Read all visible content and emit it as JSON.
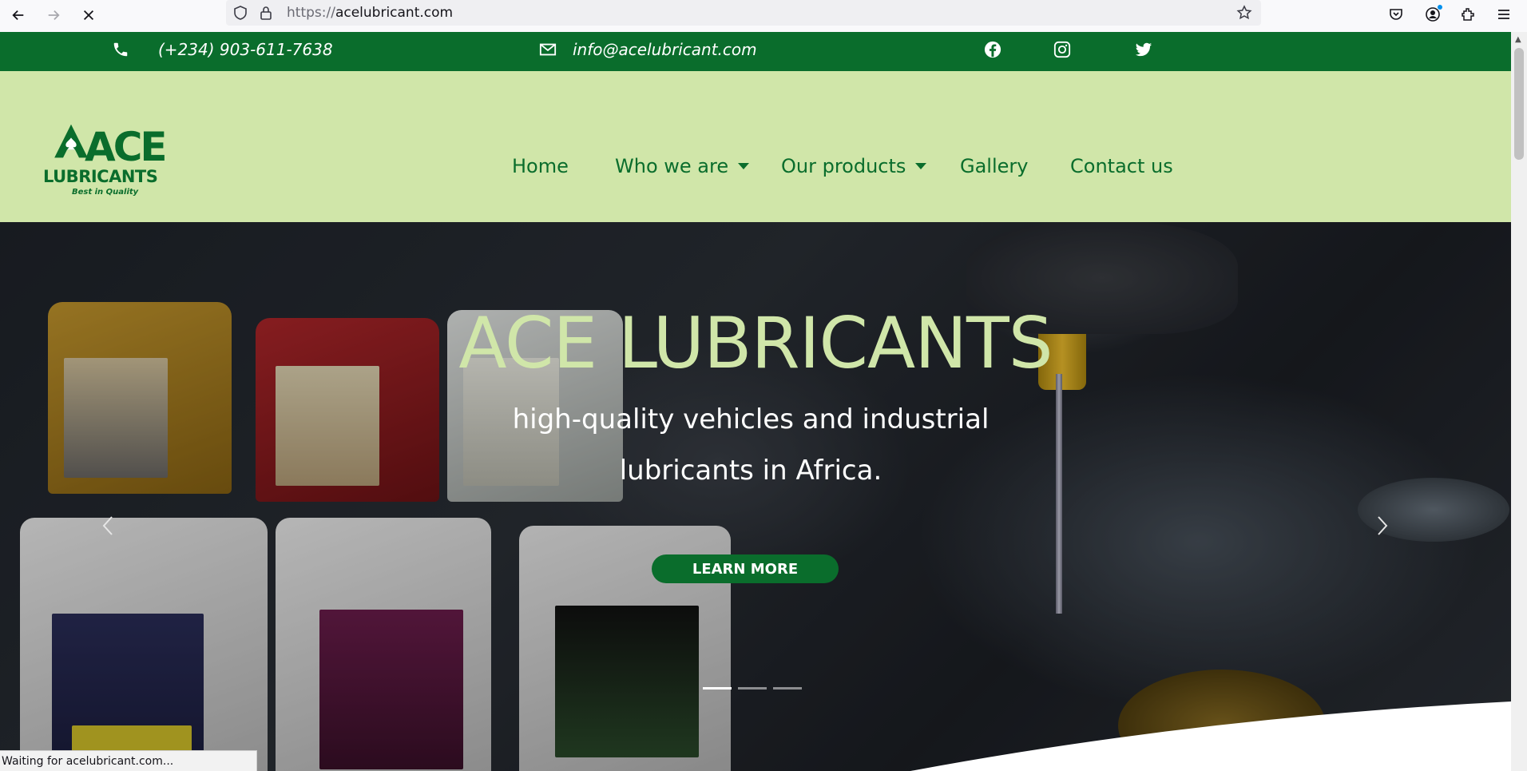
{
  "browser": {
    "url_scheme": "https://",
    "url_host": "acelubricant.com",
    "status_text": "Waiting for acelubricant.com..."
  },
  "topbar": {
    "phone": "(+234) 903-611-7638",
    "email": "info@acelubricant.com",
    "social": [
      "facebook-icon",
      "instagram-icon",
      "twitter-icon"
    ]
  },
  "logo": {
    "name": "ACE",
    "subtitle": "LUBRICANTS",
    "tagline": "Best in Quality"
  },
  "nav": {
    "items": [
      {
        "label": "Home",
        "dropdown": false
      },
      {
        "label": "Who we are",
        "dropdown": true
      },
      {
        "label": "Our products",
        "dropdown": true
      },
      {
        "label": "Gallery",
        "dropdown": false
      },
      {
        "label": "Contact us",
        "dropdown": false
      }
    ]
  },
  "hero": {
    "title": "ACE LUBRICANTS",
    "subtitle": "high-quality vehicles and industrial lubricants in Africa.",
    "button": "LEARN MORE",
    "slides": 3,
    "active_slide": 1
  },
  "colors": {
    "brand_green": "#0a6d2c",
    "light_green": "#d0e6a9",
    "white": "#ffffff"
  }
}
